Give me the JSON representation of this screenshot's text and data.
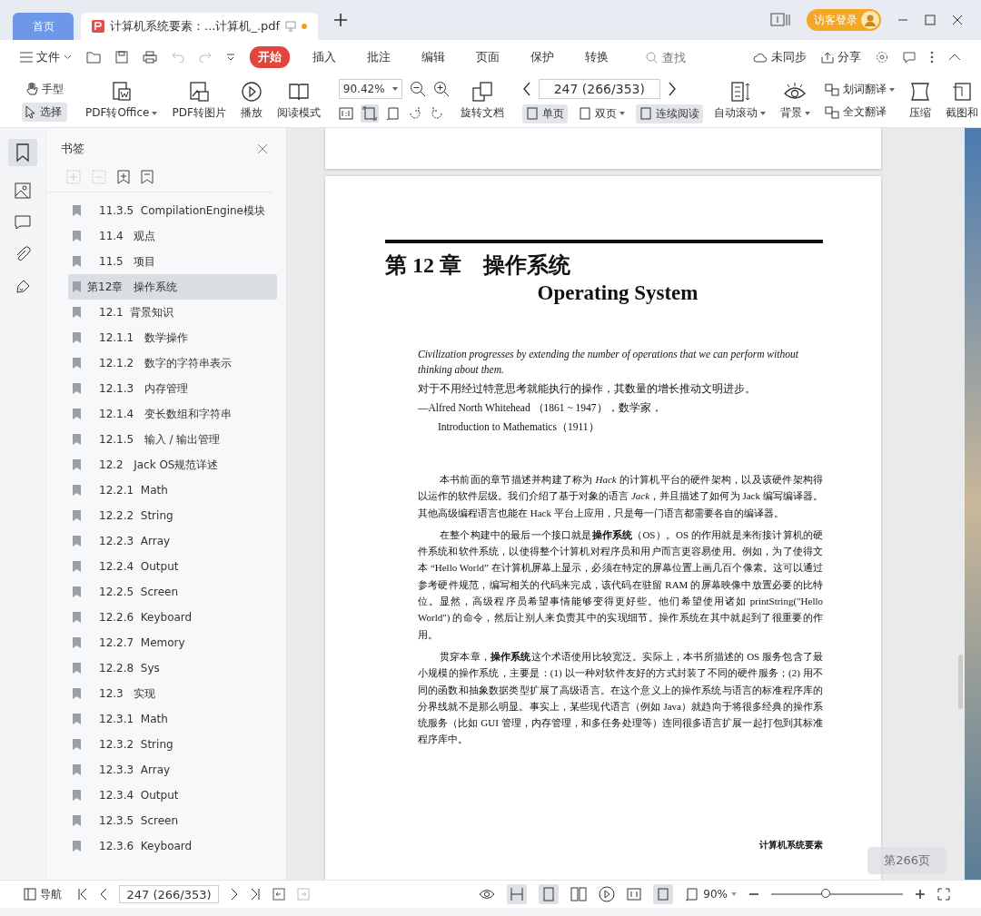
{
  "tabs": [
    {
      "label": "首页",
      "kind": "home",
      "selected": false
    },
    {
      "label": "计算机系统要素：...计算机_.pdf",
      "kind": "file",
      "selected": true,
      "unsaved": true
    }
  ],
  "title_bar": {
    "login": "访客登录"
  },
  "menu": {
    "file": "文件",
    "items": [
      {
        "label": "开始",
        "selected": true
      },
      {
        "label": "插入",
        "selected": false
      },
      {
        "label": "批注",
        "selected": false
      },
      {
        "label": "编辑",
        "selected": false
      },
      {
        "label": "页面",
        "selected": false
      },
      {
        "label": "保护",
        "selected": false
      },
      {
        "label": "转换",
        "selected": false
      }
    ],
    "search_placeholder": "查找",
    "sync": "未同步",
    "share": "分享"
  },
  "ribbon": {
    "hand": "手型",
    "select": "选择",
    "select_selected": true,
    "big_tools": [
      {
        "label": "PDF转Office",
        "dropdown": true
      },
      {
        "label": "PDF转图片",
        "dropdown": false
      },
      {
        "label": "播放",
        "dropdown": false
      },
      {
        "label": "阅读模式",
        "dropdown": false
      }
    ],
    "zoom": "90.42%",
    "rotate": "旋转文档",
    "page_field": "247 (266/353)",
    "views": [
      {
        "label": "单页",
        "selected": true,
        "dropdown": false
      },
      {
        "label": "双页",
        "selected": false,
        "dropdown": true
      },
      {
        "label": "连续阅读",
        "selected": true,
        "dropdown": false
      }
    ],
    "right_tools": [
      {
        "label": "自动滚动",
        "dropdown": true
      },
      {
        "label": "背景",
        "dropdown": true
      }
    ],
    "translate": [
      {
        "label": "划词翻译",
        "dropdown": true
      },
      {
        "label": "全文翻译",
        "dropdown": false
      }
    ],
    "tail_tools": [
      {
        "label": "压缩"
      },
      {
        "label": "截图和"
      }
    ]
  },
  "sidebar": {
    "title": "书签",
    "bookmarks": [
      {
        "label": "11.3.5  CompilationEngine模块",
        "kind": "section",
        "selected": false
      },
      {
        "label": "11.4   观点",
        "kind": "section",
        "selected": false
      },
      {
        "label": "11.5   项目",
        "kind": "section",
        "selected": false
      },
      {
        "label": "第12章   操作系统",
        "kind": "chapter",
        "selected": true
      },
      {
        "label": "12.1  背景知识",
        "kind": "section",
        "selected": false
      },
      {
        "label": "12.1.1   数学操作",
        "kind": "section",
        "selected": false
      },
      {
        "label": "12.1.2   数字的字符串表示",
        "kind": "section",
        "selected": false
      },
      {
        "label": "12.1.3   内存管理",
        "kind": "section",
        "selected": false
      },
      {
        "label": "12.1.4   变长数组和字符串",
        "kind": "section",
        "selected": false
      },
      {
        "label": "12.1.5   输入 / 输出管理",
        "kind": "section",
        "selected": false
      },
      {
        "label": "12.2   Jack OS规范详述",
        "kind": "section",
        "selected": false
      },
      {
        "label": "12.2.1  Math",
        "kind": "section",
        "selected": false
      },
      {
        "label": "12.2.2  String",
        "kind": "section",
        "selected": false
      },
      {
        "label": "12.2.3  Array",
        "kind": "section",
        "selected": false
      },
      {
        "label": "12.2.4  Output",
        "kind": "section",
        "selected": false
      },
      {
        "label": "12.2.5  Screen",
        "kind": "section",
        "selected": false
      },
      {
        "label": "12.2.6  Keyboard",
        "kind": "section",
        "selected": false
      },
      {
        "label": "12.2.7  Memory",
        "kind": "section",
        "selected": false
      },
      {
        "label": "12.2.8  Sys",
        "kind": "section",
        "selected": false
      },
      {
        "label": "12.3   实现",
        "kind": "section",
        "selected": false
      },
      {
        "label": "12.3.1  Math",
        "kind": "section",
        "selected": false
      },
      {
        "label": "12.3.2  String",
        "kind": "section",
        "selected": false
      },
      {
        "label": "12.3.3  Array",
        "kind": "section",
        "selected": false
      },
      {
        "label": "12.3.4  Output",
        "kind": "section",
        "selected": false
      },
      {
        "label": "12.3.5  Screen",
        "kind": "section",
        "selected": false
      },
      {
        "label": "12.3.6  Keyboard",
        "kind": "section",
        "selected": false
      }
    ]
  },
  "document": {
    "chapter_title": "第 12 章　操作系统",
    "english_title": "Operating System",
    "epigraph_en": "Civilization progresses by extending the number of operations that we can perform without thinking about them.",
    "epigraph_zh": "对于不用经过特意思考就能执行的操作，其数量的增长推动文明进步。",
    "attribution": "—Alfred North Whitehead （1861 ~ 1947），数学家，",
    "source": "Introduction to Mathematics（1911）",
    "paragraphs": [
      "本书前面的章节描述并构建了称为 *Hack* 的计算机平台的硬件架构，以及该硬件架构得以运作的软件层级。我们介绍了基于对象的语言 *Jack*，并且描述了如何为 Jack 编写编译器。其他高级编程语言也能在 Hack 平台上应用，只是每一门语言都需要各自的编译器。",
      "在整个构建中的最后一个接口就是**操作系统**（OS）。OS 的作用就是来衔接计算机的硬件系统和软件系统，以使得整个计算机对程序员和用户而言更容易使用。例如，为了使得文本 “Hello World” 在计算机屏幕上显示，必须在特定的屏幕位置上画几百个像素。这可以通过参考硬件规范，编写相关的代码来完成，该代码在驻留 RAM 的屏幕映像中放置必要的比特位。显然，高级程序员希望事情能够变得更好些。他们希望使用诸如 printString(\"Hello World\") 的命令，然后让别人来负责其中的实现细节。操作系统在其中就起到了很重要的作用。",
      "贯穿本章，**操作系统**这个术语使用比较宽泛。实际上，本书所描述的 OS 服务包含了最小规模的操作系统，主要是：(1) 以一种对软件友好的方式封装了不同的硬件服务；(2) 用不同的函数和抽象数据类型扩展了高级语言。在这个意义上的操作系统与语言的标准程序库的分界线就不是那么明显。事实上，某些现代语言（例如 Java）就趋向于将很多经典的操作系统服务（比如 GUI 管理，内存管理，和多任务处理等）连同很多语言扩展一起打包到其标准程序库中。"
    ],
    "footer": "计算机系统要素",
    "page_tooltip": "第266页"
  },
  "status_bar": {
    "nav": "导航",
    "page_field": "247 (266/353)",
    "zoom": "90%",
    "single_selected": true,
    "zoom_slider": {
      "level": 0.42
    }
  }
}
